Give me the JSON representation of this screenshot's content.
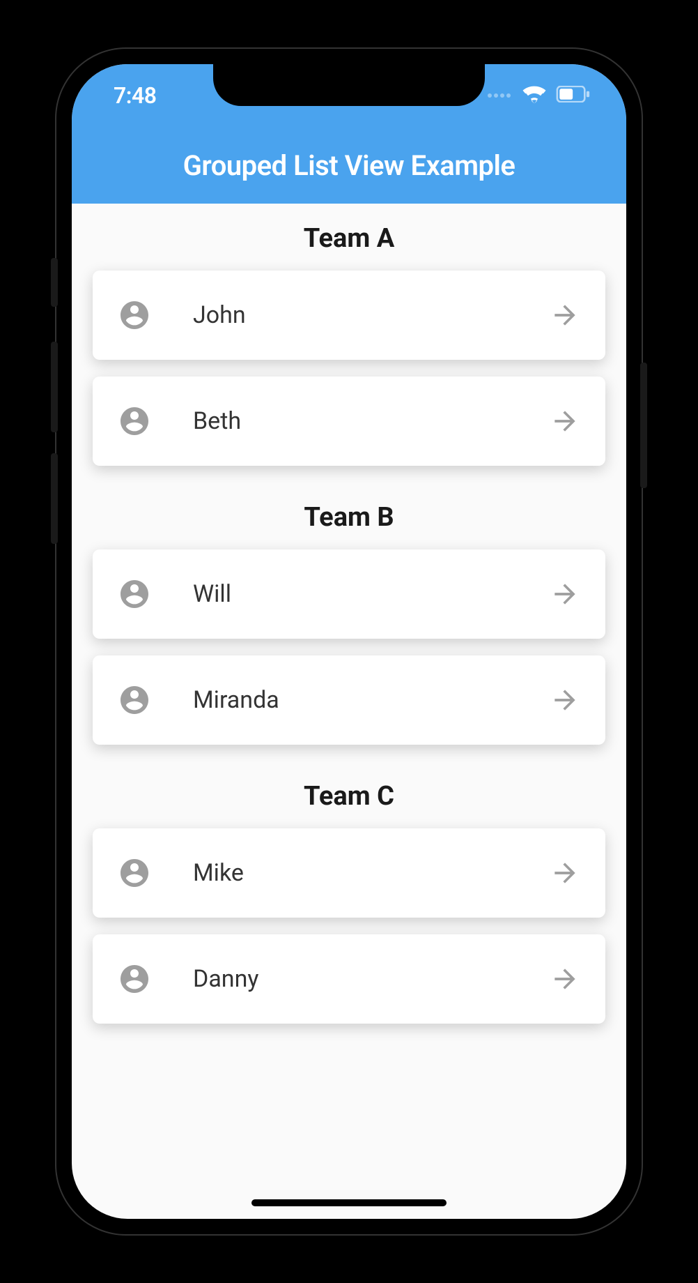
{
  "status": {
    "time": "7:48"
  },
  "appBar": {
    "title": "Grouped List View Example"
  },
  "groups": [
    {
      "header": "Team A",
      "items": [
        {
          "name": "John"
        },
        {
          "name": "Beth"
        }
      ]
    },
    {
      "header": "Team B",
      "items": [
        {
          "name": "Will"
        },
        {
          "name": "Miranda"
        }
      ]
    },
    {
      "header": "Team C",
      "items": [
        {
          "name": "Mike"
        },
        {
          "name": "Danny"
        }
      ]
    }
  ]
}
